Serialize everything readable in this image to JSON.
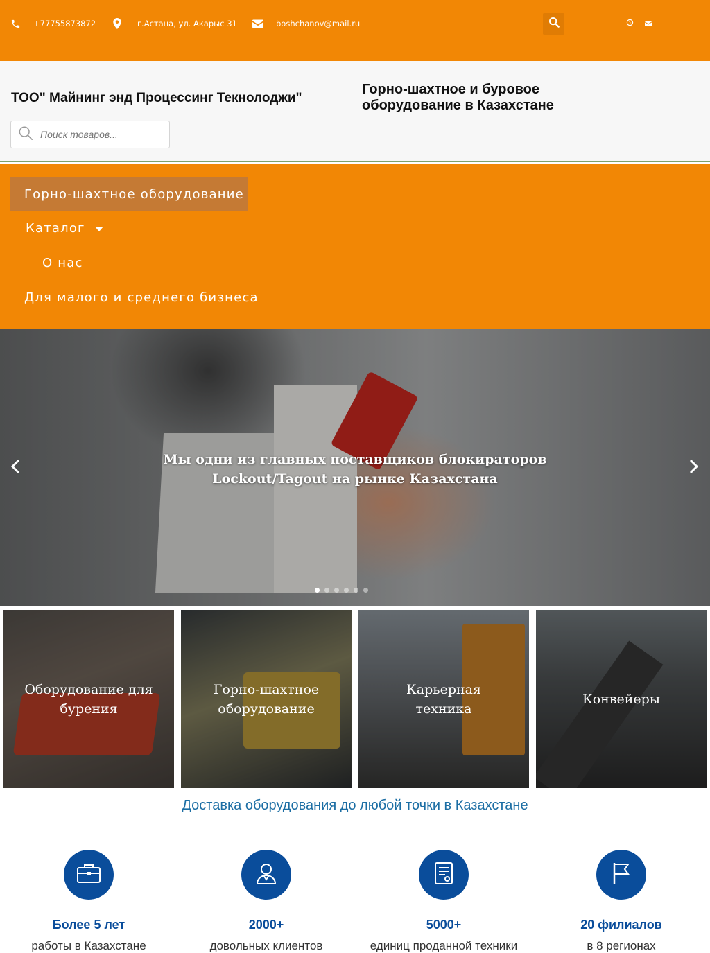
{
  "topbar": {
    "phone": "+77755873872",
    "address": "г.Астана, ул. Акарыс 31",
    "email": "boshchanov@mail.ru",
    "icons": [
      "phone-icon",
      "location-icon",
      "envelope-icon",
      "search-icon",
      "whatsapp-icon",
      "mail-icon"
    ]
  },
  "header": {
    "company": "ТОО\" Майнинг энд Процессинг Текнолоджи\"",
    "tagline": "Горно-шахтное и буровое оборудование в Казахстане",
    "search_placeholder": "Поиск товаров..."
  },
  "nav": {
    "items": [
      {
        "label": "Горно-шахтное оборудование",
        "active": true
      },
      {
        "label": "Каталог",
        "has_dropdown": true
      },
      {
        "label": "О нас"
      },
      {
        "label": "Для малого и среднего бизнеса"
      }
    ]
  },
  "hero": {
    "title": "Мы одни из главных поставщиков блокираторов Lockout/Tagout на рынке Казахстана",
    "slide_count": 6,
    "active_slide": 1
  },
  "categories": [
    {
      "label": "Оборудование для бурения"
    },
    {
      "label": "Горно-шахтное оборудование"
    },
    {
      "label": "Карьерная техника"
    },
    {
      "label": "Конвейеры"
    }
  ],
  "delivery": "Доставка оборудования до любой точки в Казахстане",
  "features": [
    {
      "icon": "briefcase-icon",
      "number": "Более 5 лет",
      "desc": "работы в Казахстане"
    },
    {
      "icon": "user-icon",
      "number": "2000+",
      "desc": "довольных клиентов"
    },
    {
      "icon": "document-icon",
      "number": "5000+",
      "desc": "единиц проданной техники"
    },
    {
      "icon": "flag-icon",
      "number": "20 филиалов",
      "desc": "в 8 регионах"
    }
  ],
  "colors": {
    "brand_orange": "#f28705",
    "nav_active": "#c57a34",
    "accent_blue": "#0a4d9b",
    "link_blue": "#1c6ea4"
  }
}
